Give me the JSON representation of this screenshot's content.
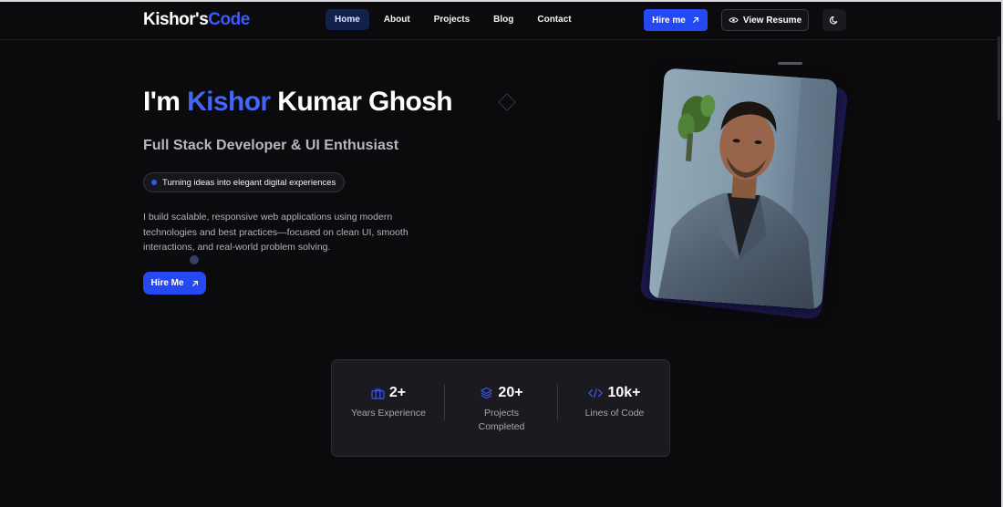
{
  "nav": {
    "logo_main": "Kishor's",
    "logo_accent": "Code",
    "links": [
      {
        "label": "Home",
        "active": true
      },
      {
        "label": "About",
        "active": false
      },
      {
        "label": "Projects",
        "active": false
      },
      {
        "label": "Blog",
        "active": false
      },
      {
        "label": "Contact",
        "active": false
      }
    ],
    "hire_label": "Hire me",
    "hire_icon": "arrow-up-right-icon",
    "resume_label": "View Resume",
    "resume_icon": "eye-icon",
    "theme_icon": "moon-icon"
  },
  "hero": {
    "greeting": "I'm ",
    "name_accent": "Kishor",
    "name_rest": " Kumar Ghosh",
    "subtitle": "Full Stack Developer & UI Enthusiast",
    "pill_text": "Turning ideas into elegant digital experiences",
    "description": "I build scalable, responsive web applications using modern technologies and best practices—focused on clean UI, smooth interactions, and real-world problem solving.",
    "cta_label": "Hire Me",
    "cta_icon": "arrow-up-right-icon"
  },
  "stats": [
    {
      "icon": "briefcase-icon",
      "value": "2+",
      "label": "Years Experience"
    },
    {
      "icon": "layers-icon",
      "value": "20+",
      "label": "Projects Completed"
    },
    {
      "icon": "code-icon",
      "value": "10k+",
      "label": "Lines of Code"
    }
  ],
  "colors": {
    "background": "#0b0a0d",
    "accent": "#2449f2",
    "accent_text": "#4366f7",
    "card": "#1b1a20"
  }
}
